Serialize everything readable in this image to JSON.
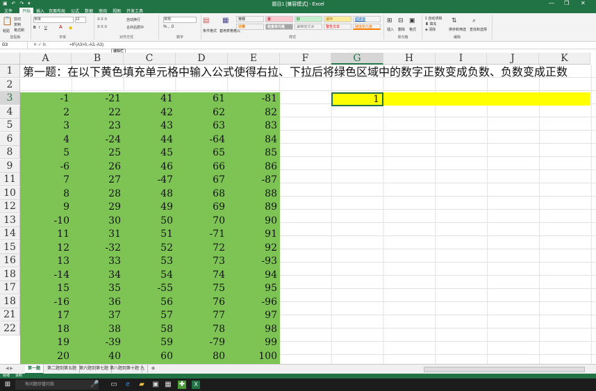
{
  "window": {
    "title": "题目1 [兼容模式] - Excel",
    "minimize": "—",
    "restore": "❐",
    "close": "✕"
  },
  "menu_tabs": [
    "文件",
    "开始",
    "插入",
    "页面布局",
    "公式",
    "数据",
    "审阅",
    "视图",
    "开发工具"
  ],
  "ribbon": {
    "clipboard": {
      "paste": "粘贴",
      "cut": "剪切",
      "copy": "复制",
      "format_painter": "格式刷",
      "label": "剪贴板"
    },
    "font": {
      "name": "宋体",
      "size": "12",
      "bold": "B",
      "italic": "I",
      "underline": "U",
      "label": "字体"
    },
    "alignment": {
      "wrap": "自动换行",
      "merge": "合并后居中",
      "label": "对齐方式"
    },
    "number": {
      "format": "常规",
      "label": "数字"
    },
    "styles": {
      "conditional": "条件格式",
      "table": "套用表格格式",
      "items": [
        {
          "text": "常规",
          "bg": "#ffffff",
          "fg": "#000000"
        },
        {
          "text": "差",
          "bg": "#ffc7ce",
          "fg": "#9c0006"
        },
        {
          "text": "好",
          "bg": "#c6efce",
          "fg": "#006100"
        },
        {
          "text": "适中",
          "bg": "#ffeb9c",
          "fg": "#9c5700"
        },
        {
          "text": "超链接",
          "bg": "#ffffff",
          "fg": "#0563c1"
        },
        {
          "text": "计算",
          "bg": "#f2f2f2",
          "fg": "#fa7d00"
        },
        {
          "text": "检查单元格",
          "bg": "#a5a5a5",
          "fg": "#ffffff"
        },
        {
          "text": "解释性文本",
          "bg": "#ffffff",
          "fg": "#7f7f7f"
        },
        {
          "text": "警告文本",
          "bg": "#ffffff",
          "fg": "#ff0000"
        },
        {
          "text": "链接单元格",
          "bg": "#ffffff",
          "fg": "#fa7d00"
        }
      ],
      "label": "样式"
    },
    "cells": {
      "insert": "插入",
      "delete": "删除",
      "format": "格式",
      "label": "单元格"
    },
    "editing": {
      "autosum": "自动求和",
      "fill": "填充",
      "clear": "清除",
      "sort": "排序和筛选",
      "find": "查找和选择",
      "label": "编辑"
    }
  },
  "formula_bar": {
    "name_box": "G3",
    "formula": "=IF(A3>0,-A3,-A3)",
    "tooltip": "编辑栏"
  },
  "sheet": {
    "columns": [
      "A",
      "B",
      "C",
      "D",
      "E",
      "F",
      "G",
      "H",
      "I",
      "J",
      "K"
    ],
    "rows": [
      "1",
      "2",
      "3",
      "4",
      "5",
      "6",
      "8",
      "9",
      "11",
      "10",
      "12",
      "13",
      "14",
      "15",
      "16",
      "18",
      "17",
      "18",
      "21",
      "22"
    ],
    "title_text": "第一题：在以下黄色填充单元格中输入公式使得右拉、下拉后将绿色区域中的数字正数变成负数、负数变成正数",
    "data": [
      [
        "-1",
        "-21",
        "41",
        "61",
        "-81"
      ],
      [
        "2",
        "22",
        "42",
        "62",
        "82"
      ],
      [
        "3",
        "23",
        "43",
        "63",
        "83"
      ],
      [
        "4",
        "-24",
        "44",
        "-64",
        "84"
      ],
      [
        "5",
        "25",
        "45",
        "65",
        "85"
      ],
      [
        "-6",
        "26",
        "46",
        "66",
        "86"
      ],
      [
        "7",
        "27",
        "-47",
        "67",
        "-87"
      ],
      [
        "8",
        "28",
        "48",
        "68",
        "88"
      ],
      [
        "9",
        "29",
        "49",
        "69",
        "89"
      ],
      [
        "-10",
        "30",
        "50",
        "70",
        "90"
      ],
      [
        "11",
        "31",
        "51",
        "-71",
        "91"
      ],
      [
        "12",
        "-32",
        "52",
        "72",
        "92"
      ],
      [
        "13",
        "33",
        "53",
        "73",
        "-93"
      ],
      [
        "-14",
        "34",
        "54",
        "74",
        "94"
      ],
      [
        "15",
        "35",
        "-55",
        "75",
        "95"
      ],
      [
        "-16",
        "36",
        "56",
        "76",
        "-96"
      ],
      [
        "17",
        "37",
        "57",
        "77",
        "97"
      ],
      [
        "18",
        "38",
        "58",
        "78",
        "98"
      ],
      [
        "19",
        "-39",
        "59",
        "-79",
        "99"
      ],
      [
        "20",
        "40",
        "60",
        "80",
        "100"
      ]
    ],
    "active_value": "1",
    "colors": {
      "green": "#7dc455",
      "yellow": "#ffff00",
      "accent": "#217346"
    }
  },
  "sheet_tabs": [
    "第一题",
    "第二题到第五题",
    "第六题到第七题",
    "第八题到第十题",
    "九"
  ],
  "sheet_tab_add": "⊕",
  "status": {
    "ready": "就绪",
    "mode": "录制"
  },
  "taskbar": {
    "start_icon": "windows-icon",
    "search_placeholder": "有问题尽管问我",
    "icons": [
      "mic-icon",
      "task-view-icon",
      "edge-icon",
      "explorer-icon",
      "store-icon",
      "calculator-icon",
      "app-icon",
      "excel-icon"
    ]
  }
}
